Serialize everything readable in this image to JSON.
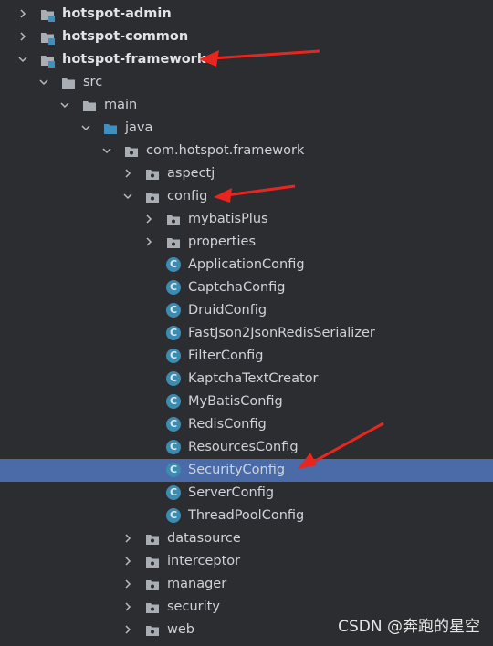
{
  "tree": [
    {
      "label": "hotspot-admin",
      "kind": "module",
      "expanded": false,
      "bold": true
    },
    {
      "label": "hotspot-common",
      "kind": "module",
      "expanded": false,
      "bold": true
    },
    {
      "label": "hotspot-framework",
      "kind": "module",
      "expanded": true,
      "bold": true
    },
    {
      "label": "src",
      "kind": "folder",
      "expanded": true
    },
    {
      "label": "main",
      "kind": "folder",
      "expanded": true
    },
    {
      "label": "java",
      "kind": "source-folder",
      "expanded": true
    },
    {
      "label": "com.hotspot.framework",
      "kind": "package",
      "expanded": true
    },
    {
      "label": "aspectj",
      "kind": "package",
      "expanded": false
    },
    {
      "label": "config",
      "kind": "package",
      "expanded": true
    },
    {
      "label": "mybatisPlus",
      "kind": "package",
      "expanded": false
    },
    {
      "label": "properties",
      "kind": "package",
      "expanded": false
    },
    {
      "label": "ApplicationConfig",
      "kind": "class"
    },
    {
      "label": "CaptchaConfig",
      "kind": "class"
    },
    {
      "label": "DruidConfig",
      "kind": "class"
    },
    {
      "label": "FastJson2JsonRedisSerializer",
      "kind": "class"
    },
    {
      "label": "FilterConfig",
      "kind": "class"
    },
    {
      "label": "KaptchaTextCreator",
      "kind": "class"
    },
    {
      "label": "MyBatisConfig",
      "kind": "class"
    },
    {
      "label": "RedisConfig",
      "kind": "class"
    },
    {
      "label": "ResourcesConfig",
      "kind": "class"
    },
    {
      "label": "SecurityConfig",
      "kind": "class",
      "selected": true
    },
    {
      "label": "ServerConfig",
      "kind": "class"
    },
    {
      "label": "ThreadPoolConfig",
      "kind": "class"
    },
    {
      "label": "datasource",
      "kind": "package",
      "expanded": false
    },
    {
      "label": "interceptor",
      "kind": "package",
      "expanded": false
    },
    {
      "label": "manager",
      "kind": "package",
      "expanded": false
    },
    {
      "label": "security",
      "kind": "package",
      "expanded": false
    },
    {
      "label": "web",
      "kind": "package",
      "expanded": false
    }
  ],
  "class_icon_letter": "C",
  "watermark": "CSDN @奔跑的星空",
  "colors": {
    "background": "#2b2d30",
    "selection": "#4a6aa8",
    "annotation_arrow": "#e8261f",
    "class_icon": "#3d8bb1"
  }
}
